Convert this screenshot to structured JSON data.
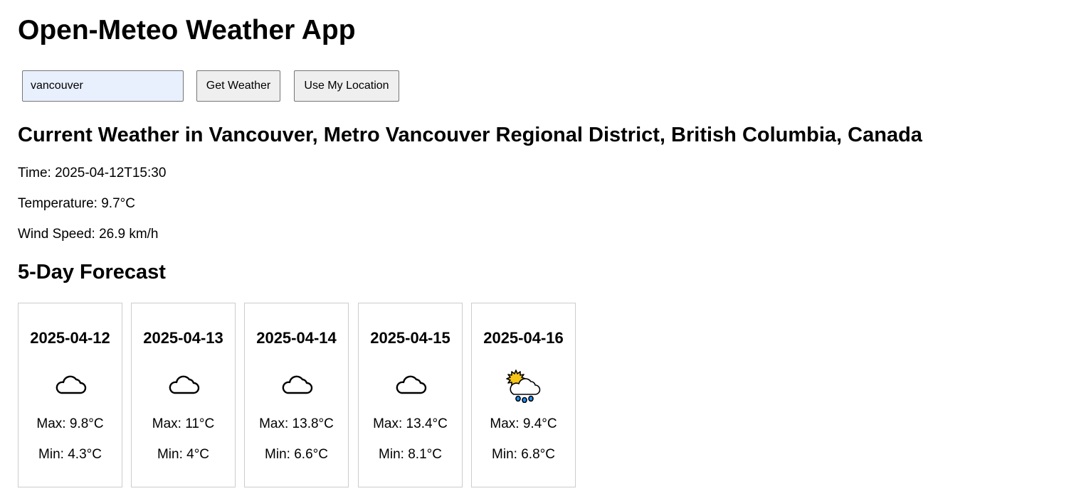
{
  "app": {
    "title": "Open-Meteo Weather App"
  },
  "search": {
    "value": "vancouver",
    "get_weather_label": "Get Weather",
    "use_location_label": "Use My Location"
  },
  "current": {
    "heading": "Current Weather in Vancouver, Metro Vancouver Regional District, British Columbia, Canada",
    "time": "Time: 2025-04-12T15:30",
    "temperature": "Temperature: 9.7°C",
    "wind_speed": "Wind Speed: 26.9 km/h"
  },
  "forecast": {
    "heading": "5-Day Forecast",
    "days": [
      {
        "date": "2025-04-12",
        "icon": "cloud-icon",
        "max": "Max: 9.8°C",
        "min": "Min: 4.3°C"
      },
      {
        "date": "2025-04-13",
        "icon": "cloud-icon",
        "max": "Max: 11°C",
        "min": "Min: 4°C"
      },
      {
        "date": "2025-04-14",
        "icon": "cloud-icon",
        "max": "Max: 13.8°C",
        "min": "Min: 6.6°C"
      },
      {
        "date": "2025-04-15",
        "icon": "cloud-icon",
        "max": "Max: 13.4°C",
        "min": "Min: 8.1°C"
      },
      {
        "date": "2025-04-16",
        "icon": "sun-rain-cloud-icon",
        "max": "Max: 9.4°C",
        "min": "Min: 6.8°C"
      }
    ]
  },
  "colors": {
    "input_autofill_bg": "#e8f0fe",
    "button_bg": "#efefef",
    "card_border": "#cccccc",
    "sun": "#f5c518",
    "rain": "#1e90ff"
  }
}
